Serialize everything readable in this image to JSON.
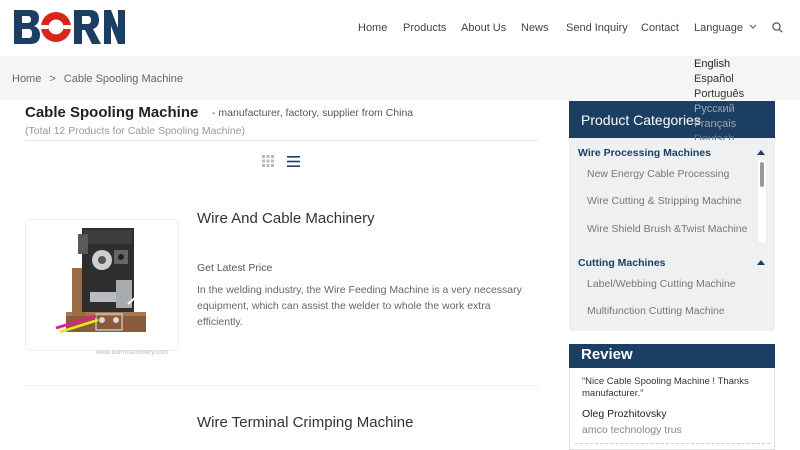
{
  "brand": {
    "logo_text": "BORN",
    "colors": {
      "navy": "#1d3e63",
      "red": "#d9251c",
      "dark_blue": "#1a3c6b"
    }
  },
  "nav": {
    "items": [
      "Home",
      "Products",
      "About Us",
      "News",
      "Send Inquiry",
      "Contact"
    ],
    "language_label": "Language",
    "language_icon": "chevron-down-icon",
    "search_icon": "search-icon"
  },
  "languages": [
    "English",
    "Español",
    "Português",
    "Русский",
    "Français",
    "Deutsch"
  ],
  "breadcrumb": {
    "home": "Home",
    "separator": ">",
    "current": "Cable Spooling Machine"
  },
  "page": {
    "title": "Cable Spooling Machine",
    "subtitle": "- manufacturer, factory, supplier from China",
    "count": "(Total 12 Products for Cable Spooling Machine)",
    "view_icons": [
      "grid-view-icon",
      "list-view-icon"
    ]
  },
  "products": [
    {
      "title": "Wire And Cable Machinery",
      "cta": "Get Latest Price",
      "description": "In the welding industry, the Wire Feeding Machine is a very necessary equipment, which can assist the welder to whole the work extra efficiently.",
      "watermark": "www.bornmachinery.com"
    },
    {
      "title": "Wire Terminal Crimping Machine"
    }
  ],
  "sidebar": {
    "categories_title": "Product Categories",
    "groups": [
      {
        "name": "Wire Processing Machines",
        "items": [
          "New Energy Cable Processing",
          "Wire Cutting & Stripping Machine",
          "Wire Shield Brush &Twist Machine"
        ]
      },
      {
        "name": "Cutting Machines",
        "items": [
          "Label/Webbing Cutting Machine",
          "Multifunction Cutting Machine"
        ]
      }
    ],
    "review_title": "Review",
    "review": {
      "quote": "“Nice Cable Spooling Machine ! Thanks manufacturer.”",
      "name": "Oleg Prozhitovsky",
      "company": "amco technology trus"
    }
  }
}
